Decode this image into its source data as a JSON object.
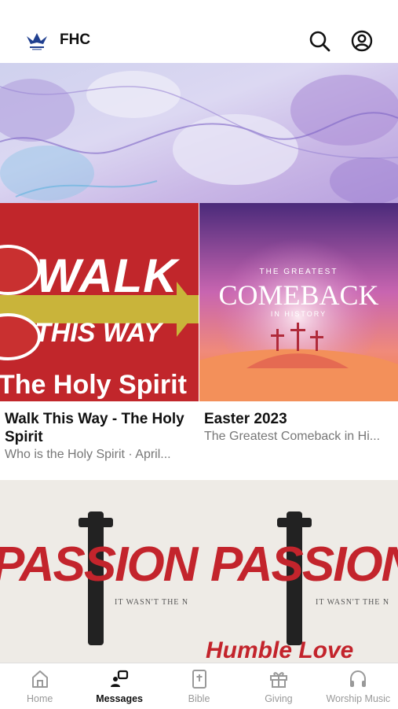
{
  "header": {
    "brand": "FHC"
  },
  "series": [
    {
      "art_line1": "WALK",
      "art_line2": "THIS WAY",
      "art_line3": "The Holy Spirit",
      "title": "Walk This Way - The Holy Spirit",
      "subtitle": "Who is the Holy Spirit · April..."
    },
    {
      "art_line1": "THE GREATEST",
      "art_line2": "COMEBACK",
      "art_line3": "IN HISTORY",
      "title": "Easter 2023",
      "subtitle": "The Greatest Comeback in Hi..."
    }
  ],
  "featured": {
    "art_word": "PASSION",
    "art_tagline": "IT WASN'T THE N",
    "art_word2": "Humble Love"
  },
  "tabs": [
    {
      "label": "Home",
      "icon": "home-icon",
      "active": false
    },
    {
      "label": "Messages",
      "icon": "messages-icon",
      "active": true
    },
    {
      "label": "Bible",
      "icon": "bible-icon",
      "active": false
    },
    {
      "label": "Giving",
      "icon": "gift-icon",
      "active": false
    },
    {
      "label": "Worship Music",
      "icon": "headphones-icon",
      "active": false
    }
  ],
  "colors": {
    "active": "#111111",
    "inactive": "#999999",
    "walk_red": "#c1262b",
    "passion_red": "#c3242c"
  }
}
